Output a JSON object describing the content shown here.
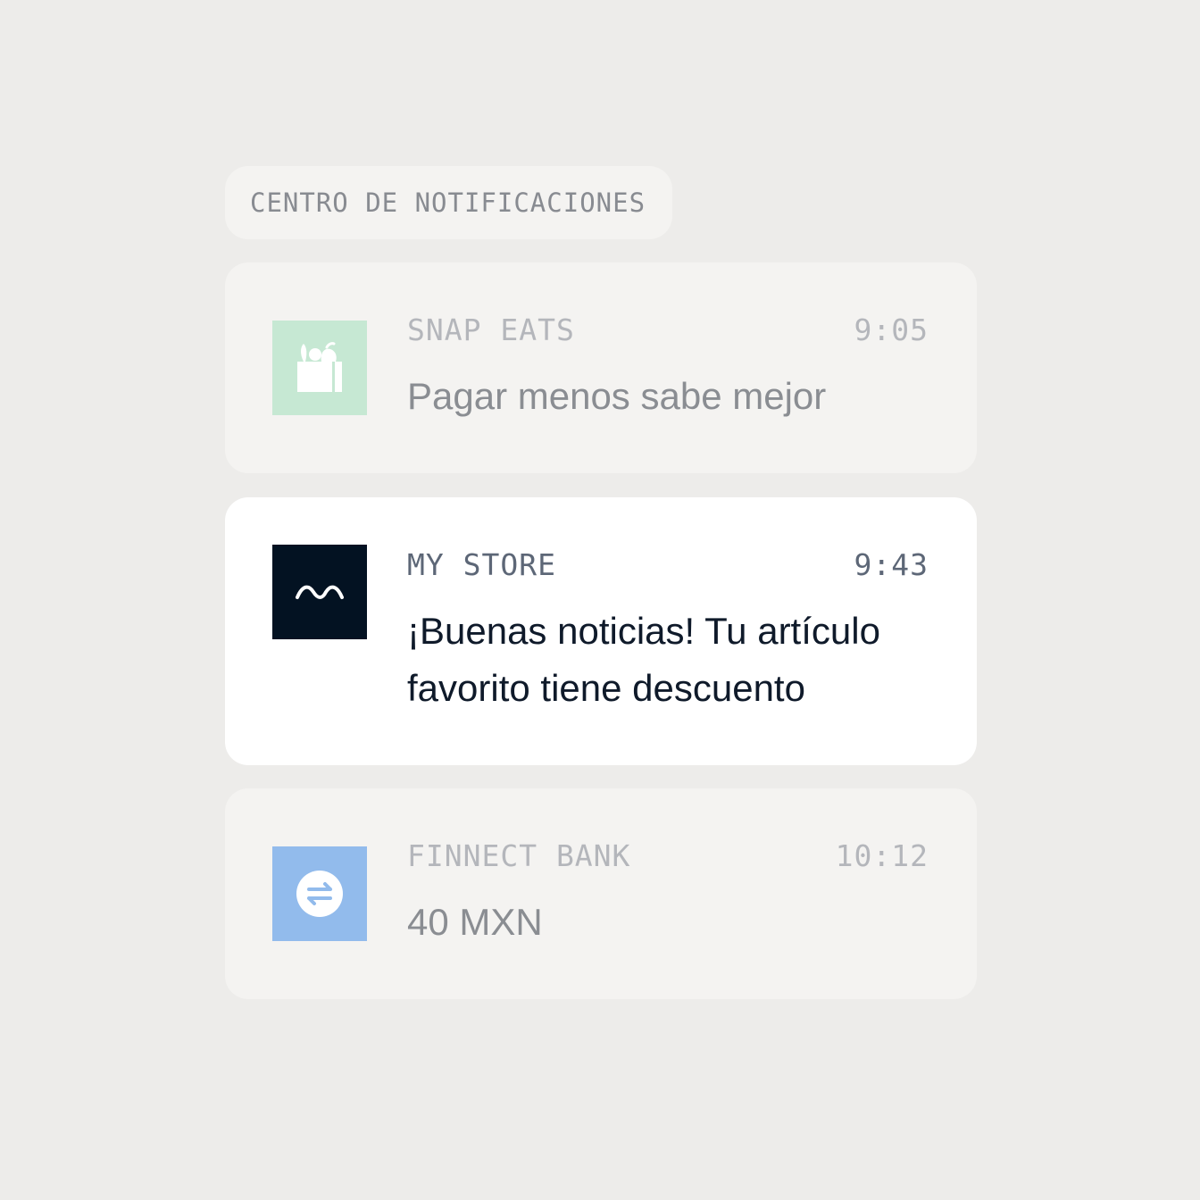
{
  "header": {
    "title": "CENTRO DE NOTIFICACIONES"
  },
  "notifications": [
    {
      "app": "SNAP EATS",
      "time": "9:05",
      "message": "Pagar menos sabe mejor",
      "icon": "grocery-bag-icon",
      "icon_bg": "#c6e8d3",
      "state": "read"
    },
    {
      "app": "MY STORE",
      "time": "9:43",
      "message": "¡Buenas noticias! Tu artículo favorito tiene descuento",
      "icon": "wave-logo-icon",
      "icon_bg": "#031222",
      "state": "unread"
    },
    {
      "app": "FINNECT BANK",
      "time": "10:12",
      "message": "40 MXN",
      "icon": "transfer-arrows-icon",
      "icon_bg": "#92bbec",
      "state": "read"
    }
  ]
}
